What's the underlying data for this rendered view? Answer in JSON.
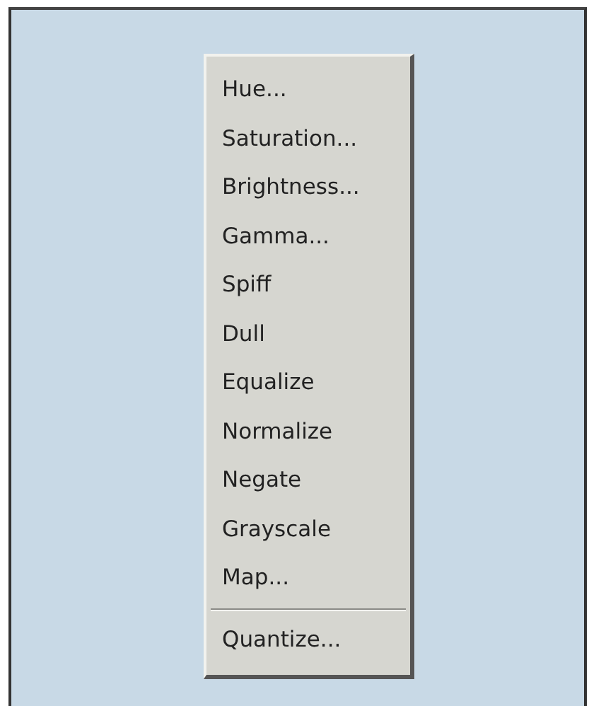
{
  "menu": {
    "items": [
      {
        "kind": "item",
        "label": "Hue..."
      },
      {
        "kind": "item",
        "label": "Saturation..."
      },
      {
        "kind": "item",
        "label": "Brightness..."
      },
      {
        "kind": "item",
        "label": "Gamma..."
      },
      {
        "kind": "item",
        "label": "Spiff"
      },
      {
        "kind": "item",
        "label": "Dull"
      },
      {
        "kind": "item",
        "label": "Equalize"
      },
      {
        "kind": "item",
        "label": "Normalize"
      },
      {
        "kind": "item",
        "label": "Negate"
      },
      {
        "kind": "item",
        "label": "Grayscale"
      },
      {
        "kind": "item",
        "label": "Map..."
      },
      {
        "kind": "separator"
      },
      {
        "kind": "item",
        "label": "Quantize..."
      }
    ]
  }
}
